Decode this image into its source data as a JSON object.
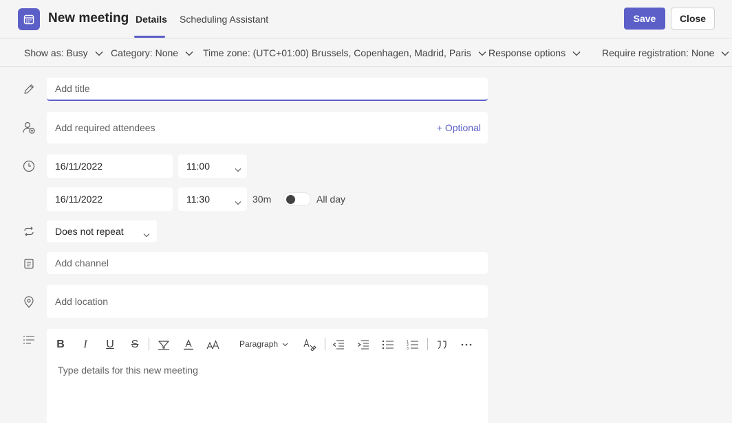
{
  "header": {
    "title": "New meeting",
    "app_icon": "calendar-icon",
    "tabs": [
      {
        "label": "Details",
        "active": true
      },
      {
        "label": "Scheduling Assistant",
        "active": false
      }
    ],
    "save_label": "Save",
    "close_label": "Close"
  },
  "options": {
    "show_as": "Show as: Busy",
    "category": "Category: None",
    "time_zone": "Time zone: (UTC+01:00) Brussels, Copenhagen, Madrid, Paris",
    "response": "Response options",
    "registration": "Require registration: None"
  },
  "form": {
    "title_placeholder": "Add title",
    "attendees_placeholder": "Add required attendees",
    "optional_label": "+ Optional",
    "start_date": "16/11/2022",
    "start_time": "11:00",
    "end_date": "16/11/2022",
    "end_time": "11:30",
    "duration": "30m",
    "all_day_label": "All day",
    "all_day_on": false,
    "repeat": "Does not repeat",
    "channel_placeholder": "Add channel",
    "location_placeholder": "Add location"
  },
  "editor": {
    "paragraph_label": "Paragraph",
    "placeholder": "Type details for this new meeting"
  },
  "colors": {
    "accent": "#5b5fc7",
    "background": "#f5f5f5"
  }
}
